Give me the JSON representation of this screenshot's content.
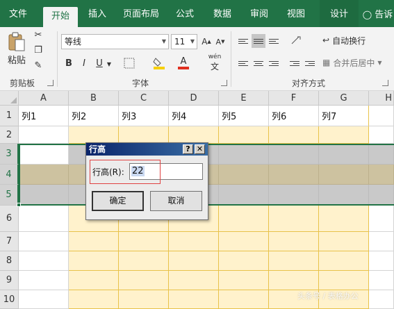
{
  "ribbon_tabs": [
    "文件",
    "开始",
    "插入",
    "页面布局",
    "公式",
    "数据",
    "审阅",
    "视图",
    "设计",
    "告诉"
  ],
  "active_tab": "开始",
  "clipboard": {
    "paste_label": "粘贴",
    "group_label": "剪贴板"
  },
  "font": {
    "name": "等线",
    "size": "11",
    "group_label": "字体",
    "bold": "B",
    "italic": "I",
    "underline": "U",
    "font_color_letter": "A",
    "phonetic_label": "wén",
    "fill_color": "#f7d000",
    "font_color": "#e03020"
  },
  "alignment": {
    "wrap_label": "自动换行",
    "merge_label": "合并后居中",
    "group_label": "对齐方式"
  },
  "columns": [
    "A",
    "B",
    "C",
    "D",
    "E",
    "F",
    "G",
    "H"
  ],
  "rows": [
    "1",
    "2",
    "3",
    "4",
    "5",
    "6",
    "7",
    "8",
    "9",
    "10"
  ],
  "header_cells": [
    "列1",
    "列2",
    "列3",
    "列4",
    "列5",
    "列6",
    "列7"
  ],
  "selected_rows": [
    "3",
    "4",
    "5"
  ],
  "dialog": {
    "title": "行高",
    "help_button": "?",
    "close_button": "✕",
    "field_label": "行高(R):",
    "field_value": "22",
    "ok_label": "确定",
    "cancel_label": "取消"
  },
  "watermark": "头条号 / 表格办公",
  "colors": {
    "excel_green": "#217346",
    "band_yellow": "#fff2cc",
    "selection_gray": "#c9c9c9"
  }
}
